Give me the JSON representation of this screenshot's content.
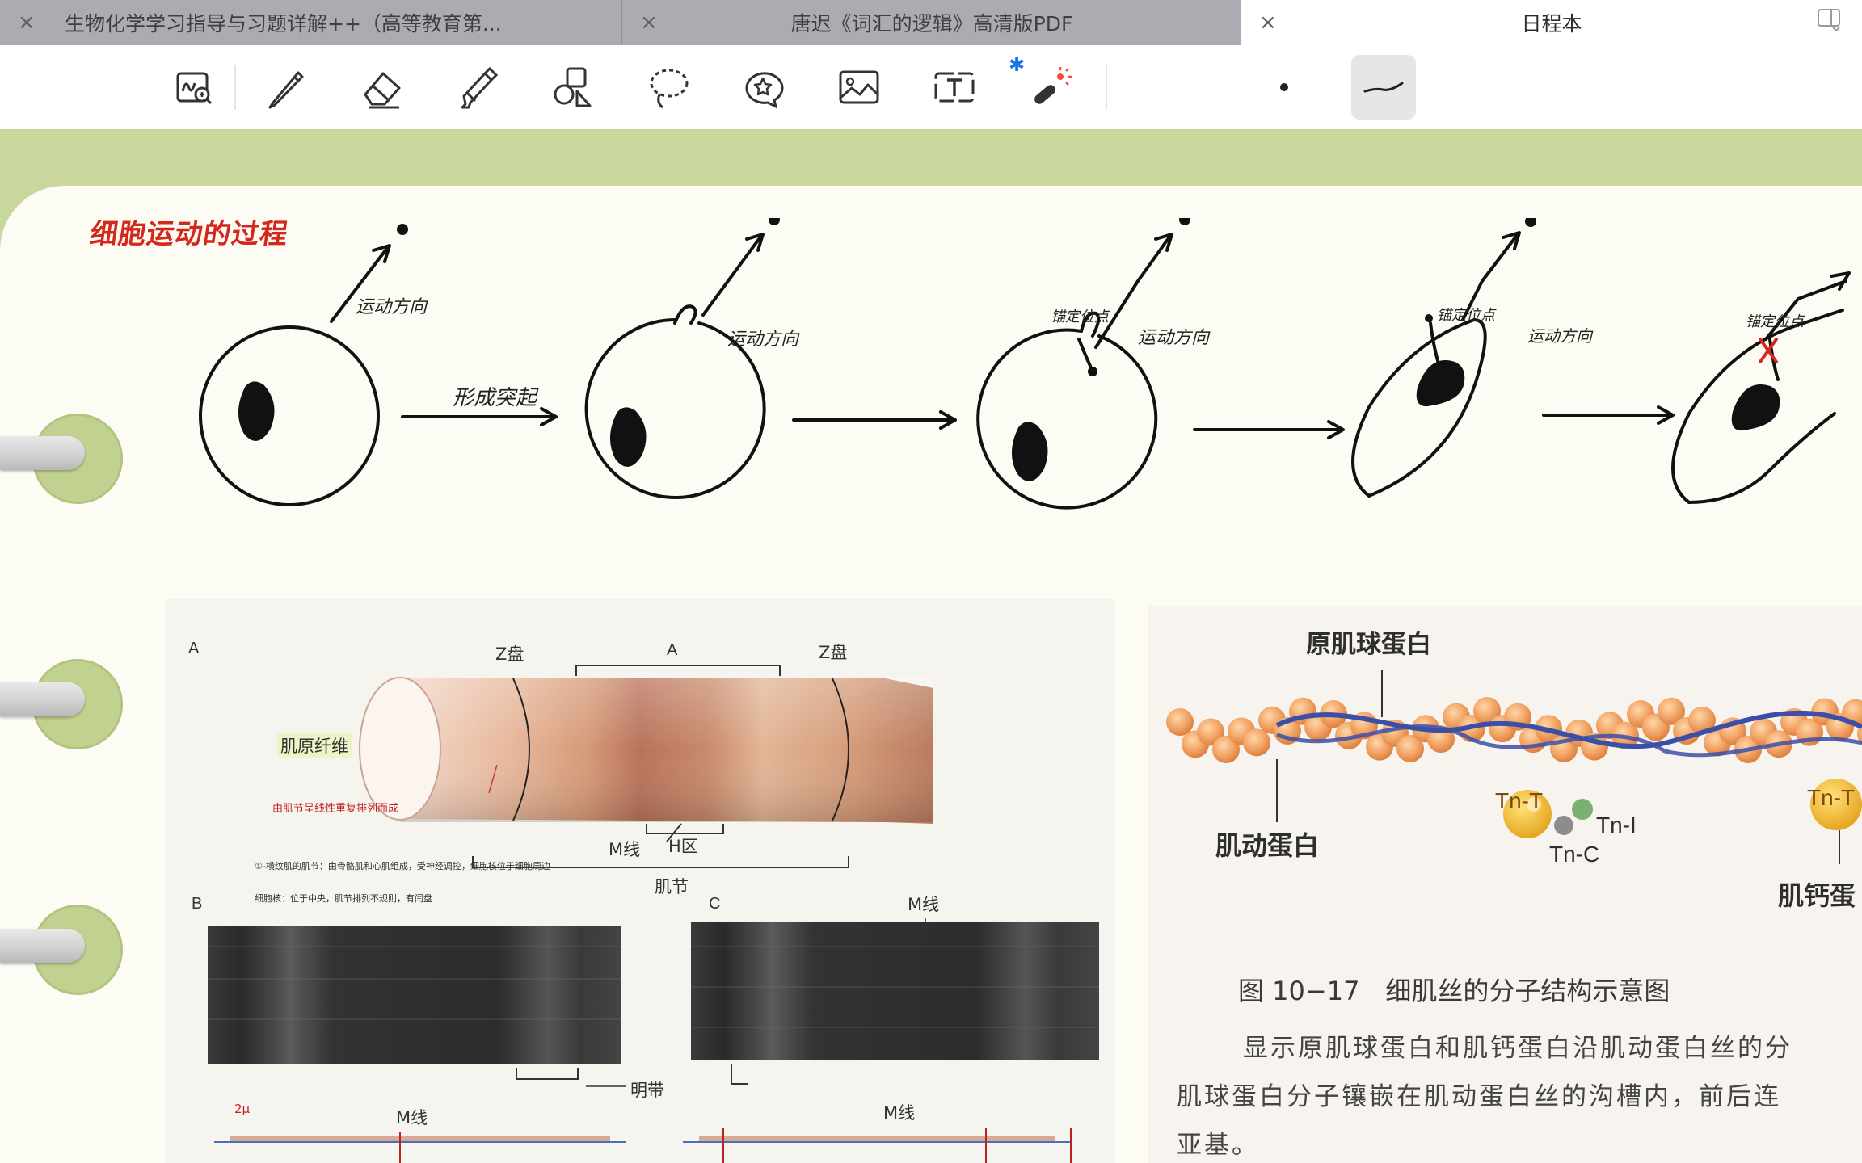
{
  "tabs": [
    {
      "title": "生物化学学习指导与习题详解++（高等教育第...",
      "close": "×"
    },
    {
      "title": "唐迟《词汇的逻辑》高清版PDF",
      "close": "×"
    },
    {
      "title": "日程本",
      "close": "×"
    }
  ],
  "toolbar": {
    "tools": [
      "zoom-handwriting-icon",
      "pen-icon",
      "eraser-icon",
      "highlighter-icon",
      "shapes-icon",
      "lasso-icon",
      "sticker-icon",
      "image-icon",
      "text-box-icon",
      "laser-pointer-icon"
    ],
    "pen_sizes": [
      "small-dot",
      "curve-stroke"
    ],
    "bluetooth_glyph": "✱"
  },
  "notes": {
    "title": "细胞运动的过程",
    "label_protrusion": "形成突起",
    "label_direction": "运动方向",
    "label_adhesion": "锚定位点"
  },
  "figure_left": {
    "label_A": "A",
    "z_disc_left": "Z盘",
    "band_A": "A",
    "z_disc_right": "Z盘",
    "myofibril": "肌原纤维",
    "red_annotation": "由肌节呈线性重复排列而成",
    "m_line": "M线",
    "h_zone": "H区",
    "sarcomere": "肌节",
    "note_line1": "①-横纹肌的肌节：由骨骼肌和心肌组成，受神经调控，细胞核位于细胞周边",
    "note_line2": "细胞核：位于中央，肌节排列不规则，有闰盘",
    "label_B": "B",
    "label_C": "C",
    "m_line_c": "M线",
    "bright_band": "明带",
    "red_small": "2μ",
    "m_line_bottom_left": "M线",
    "m_line_bottom_right": "M线"
  },
  "figure_right": {
    "tropomyosin": "原肌球蛋白",
    "actin": "肌动蛋白",
    "tnt": "Tn-T",
    "tni": "Tn-I",
    "tnc": "Tn-C",
    "tnt_right": "Tn-T",
    "troponin_partial": "肌钙蛋",
    "caption": "图 10−17　细肌丝的分子结构示意图",
    "body_line1": "显示原肌球蛋白和肌钙蛋白沿肌动蛋白丝的分",
    "body_line2": "肌球蛋白分子镶嵌在肌动蛋白丝的沟槽内，前后连",
    "body_line3": "亚基。"
  },
  "colors": {
    "tab_inactive": "#aaacb2",
    "page_bg": "#fdfcf4",
    "green_band": "#c9d79c",
    "handwriting_red": "#d4281c",
    "bluetooth_blue": "#1a73e8"
  }
}
